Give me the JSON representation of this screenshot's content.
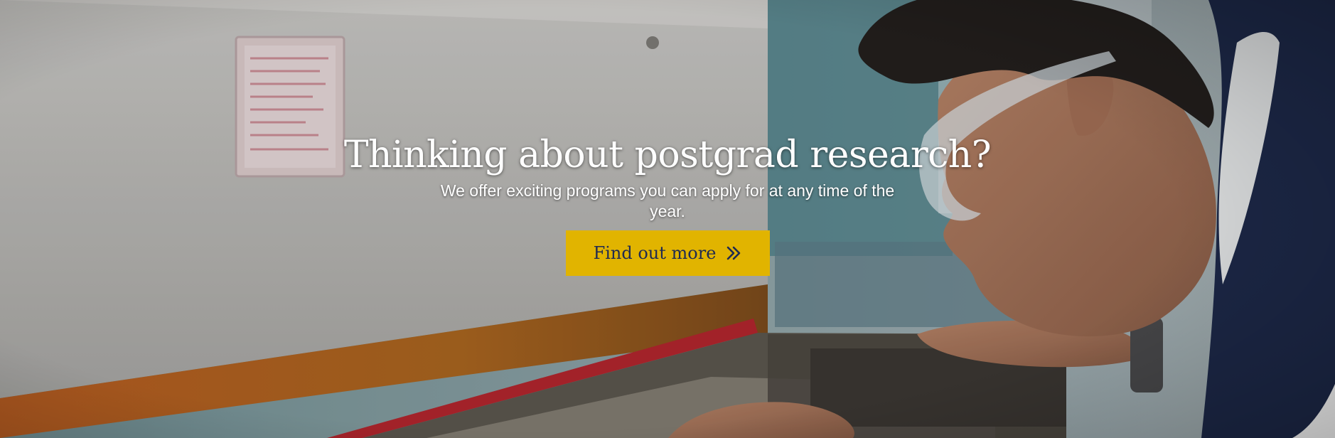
{
  "hero": {
    "title": "Thinking about postgrad research?",
    "subtitle": "We offer exciting programs you can apply for at any time of the year.",
    "cta_label": "Find out more",
    "cta_icon": "double-chevron-right-icon"
  },
  "colors": {
    "cta_background": "#e1b400",
    "cta_text": "#1f2a52",
    "title_text": "#ffffff",
    "jacket": "#1e2a4a"
  }
}
